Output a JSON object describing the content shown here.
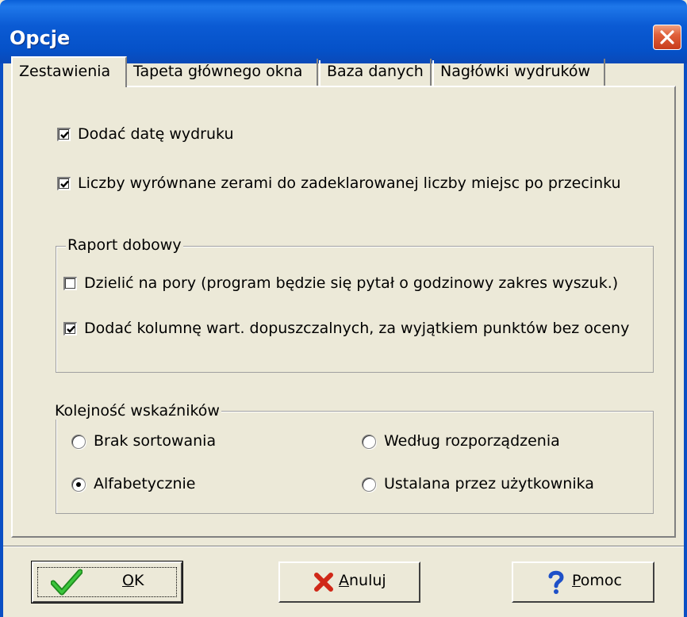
{
  "window": {
    "title": "Opcje"
  },
  "tabs": [
    {
      "label": "Zestawienia",
      "active": true
    },
    {
      "label": "Tapeta głównego okna",
      "active": false
    },
    {
      "label": "Baza danych",
      "active": false
    },
    {
      "label": "Nagłówki wydruków",
      "active": false
    }
  ],
  "options": {
    "add_print_date": {
      "label": "Dodać datę wydruku",
      "checked": true
    },
    "zero_padded": {
      "label": "Liczby wyrównane zerami do zadeklarowanej liczby miejsc po przecinku",
      "checked": true
    }
  },
  "daily_report": {
    "title": "Raport dobowy",
    "split_times": {
      "label": "Dzielić na pory (program będzie się pytał o  godzinowy  zakres wyszuk.)",
      "checked": false
    },
    "add_column": {
      "label": "Dodać kolumnę wart. dopuszczalnych, za wyjątkiem punktów bez oceny",
      "checked": true
    }
  },
  "indicator_order": {
    "title": "Kolejność wskaźników",
    "options": [
      {
        "label": "Brak sortowania",
        "selected": false
      },
      {
        "label": "Według rozporządzenia",
        "selected": false
      },
      {
        "label": "Alfabetycznie",
        "selected": true
      },
      {
        "label": "Ustalana przez użytkownika",
        "selected": false
      }
    ]
  },
  "buttons": {
    "ok": {
      "label_u": "O",
      "label_rest": "K",
      "icon": "checkmark-icon"
    },
    "cancel": {
      "label_u": "A",
      "label_rest": "nuluj",
      "icon": "red-x-icon"
    },
    "help": {
      "label_u": "P",
      "label_rest": "omoc",
      "icon": "question-mark-icon"
    }
  },
  "colors": {
    "titlebar": "#0a5fd8",
    "face": "#ece9d8",
    "close": "#e0603a",
    "ok_icon": "#2aa82a",
    "cancel_icon": "#d02818",
    "help_icon": "#1e50c8"
  }
}
